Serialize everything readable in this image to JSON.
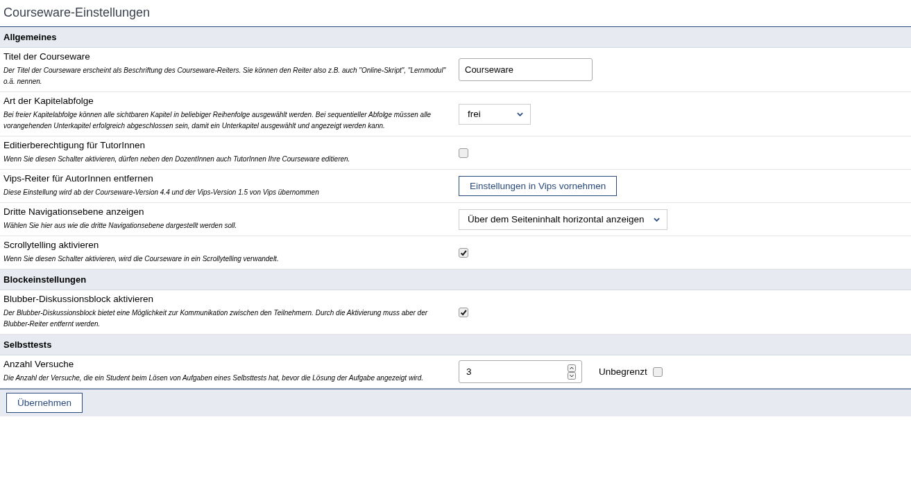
{
  "page_title": "Courseware-Einstellungen",
  "sections": [
    {
      "title": "Allgemeines",
      "rows": [
        {
          "kind": "text",
          "label": "Titel der Courseware",
          "description": "Der Titel der Courseware erscheint als Beschriftung des Courseware-Reiters. Sie können den Reiter also z.B. auch \"Online-Skript\", \"Lernmodul\" o.ä. nennen.",
          "value": "Courseware"
        },
        {
          "kind": "select",
          "label": "Art der Kapitelabfolge",
          "description": "Bei freier Kapitelabfolge können alle sichtbaren Kapitel in beliebiger Reihenfolge ausgewählt werden. Bei sequentieller Abfolge müssen alle vorangehenden Unterkapitel erfolgreich abgeschlossen sein, damit ein Unterkapitel ausgewählt und angezeigt werden kann.",
          "value": "frei"
        },
        {
          "kind": "checkbox",
          "label": "Editierberechtigung für TutorInnen",
          "description": "Wenn Sie diesen Schalter aktivieren, dürfen neben den DozentInnen auch TutorInnen Ihre Courseware editieren.",
          "checked": false
        },
        {
          "kind": "button",
          "label": "Vips-Reiter für AutorInnen entfernen",
          "description": "Diese Einstellung wird ab der Courseware-Version 4.4 und der Vips-Version 1.5 von Vips übernommen",
          "value": "Einstellungen in Vips vornehmen"
        },
        {
          "kind": "select",
          "label": "Dritte Navigationsebene anzeigen",
          "description": "Wählen Sie hier aus wie die dritte Navigationsebene dargestellt werden soll.",
          "value": "Über dem Seiteninhalt horizontal anzeigen"
        },
        {
          "kind": "checkbox",
          "label": "Scrollytelling aktivieren",
          "description": "Wenn Sie diesen Schalter aktivieren, wird die Courseware in ein Scrollytelling verwandelt.",
          "checked": true
        }
      ]
    },
    {
      "title": "Blockeinstellungen",
      "rows": [
        {
          "kind": "checkbox",
          "label": "Blubber-Diskussionsblock aktivieren",
          "description": "Der Blubber-Diskussionsblock bietet eine Möglichkeit zur Kommunikation zwischen den Teilnehmern. Durch die Aktivierung muss aber der Blubber-Reiter entfernt werden.",
          "checked": true
        }
      ]
    },
    {
      "title": "Selbsttests",
      "rows": [
        {
          "kind": "number",
          "label": "Anzahl Versuche",
          "description": "Die Anzahl der Versuche, die ein Student beim Lösen von Aufgaben eines Selbsttests hat, bevor die Lösung der Aufgabe angezeigt wird.",
          "value": "3",
          "extra_label": "Unbegrenzt",
          "extra_checked": false
        }
      ]
    }
  ],
  "submit_button": "Übernehmen"
}
